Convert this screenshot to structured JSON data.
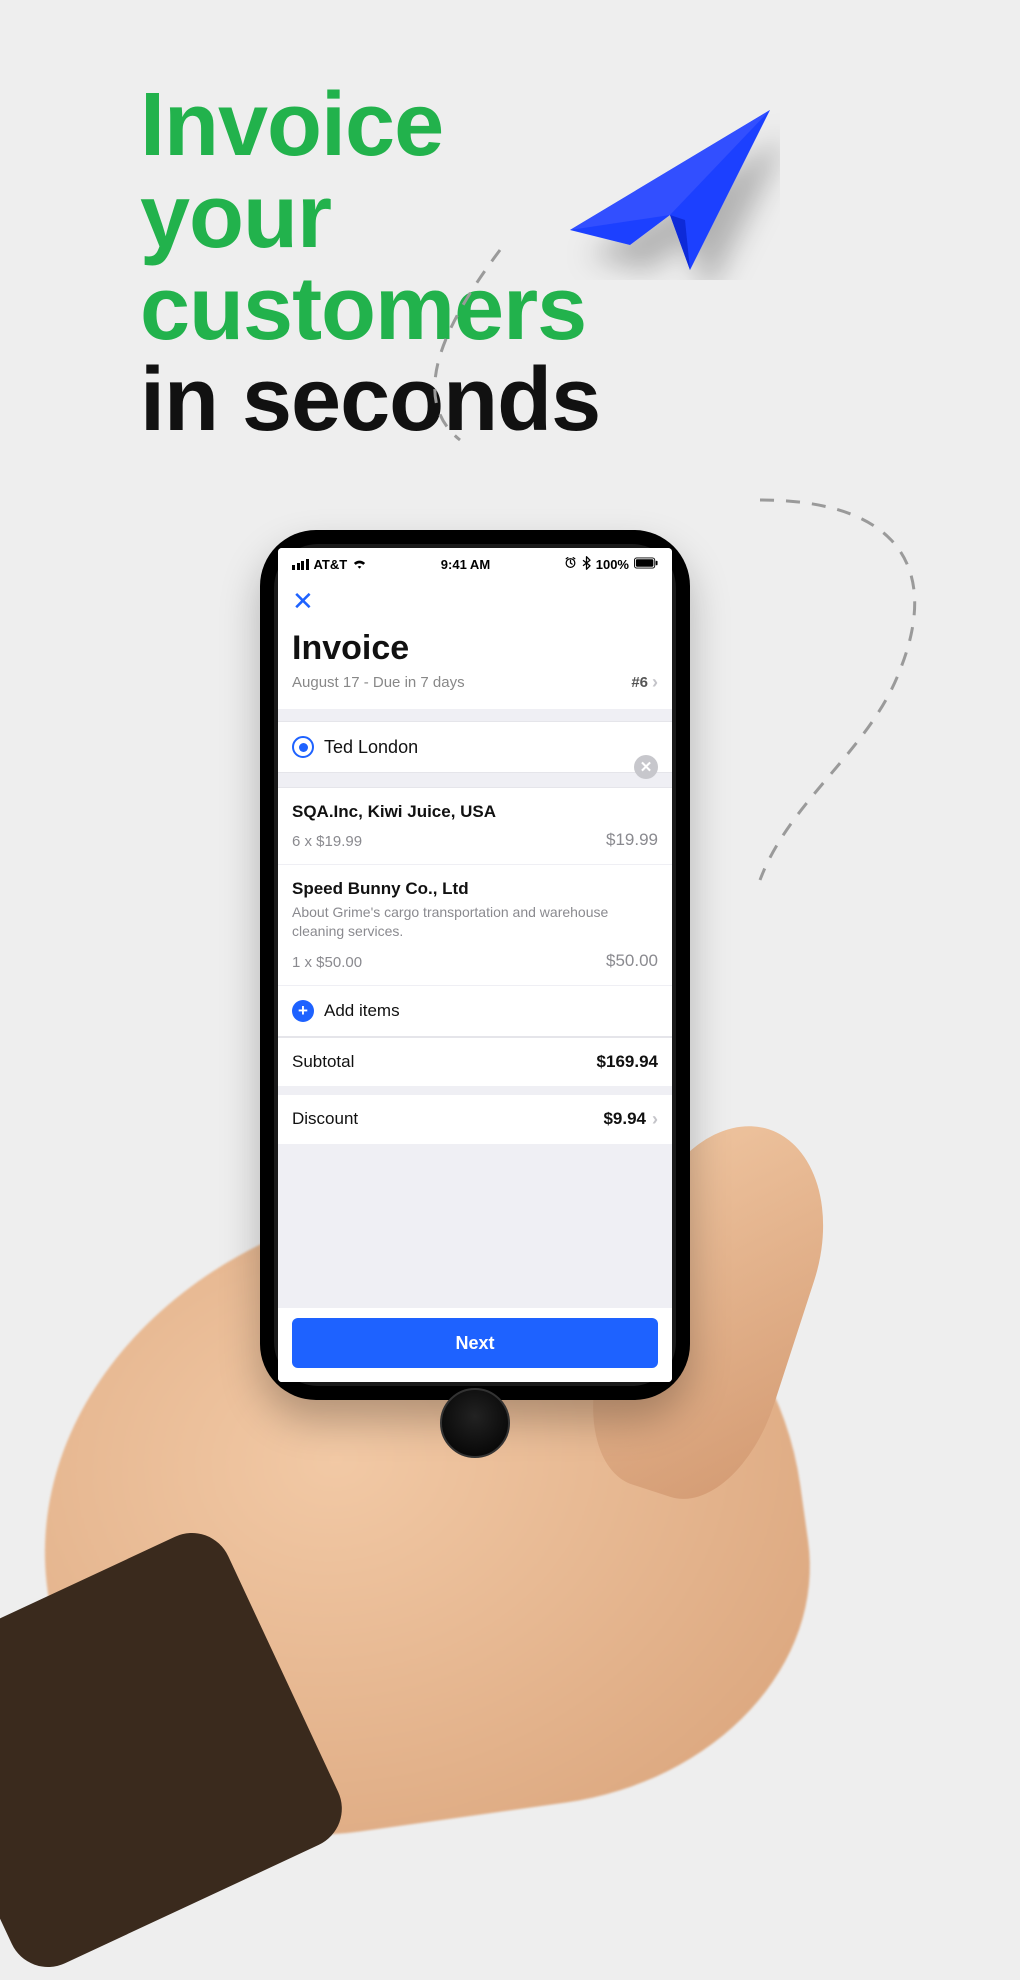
{
  "hero": {
    "line1": "Invoice",
    "line2": "your",
    "line3": "customers",
    "line4": "in seconds"
  },
  "statusbar": {
    "carrier": "AT&T",
    "time": "9:41 AM",
    "battery": "100%"
  },
  "app": {
    "title": "Invoice",
    "subtitle": "August 17 - Due in 7 days",
    "invoice_number": "#6",
    "customer": "Ted London",
    "items": [
      {
        "title": "SQA.Inc, Kiwi Juice, USA",
        "desc": "",
        "qty": "6 x $19.99",
        "price": "$19.99"
      },
      {
        "title": "Speed Bunny Co., Ltd",
        "desc": "About Grime's cargo transportation and warehouse cleaning services.",
        "qty": "1 x $50.00",
        "price": "$50.00"
      }
    ],
    "add_items_label": "Add items",
    "subtotal_label": "Subtotal",
    "subtotal_value": "$169.94",
    "discount_label": "Discount",
    "discount_value": "$9.94",
    "next_label": "Next"
  }
}
